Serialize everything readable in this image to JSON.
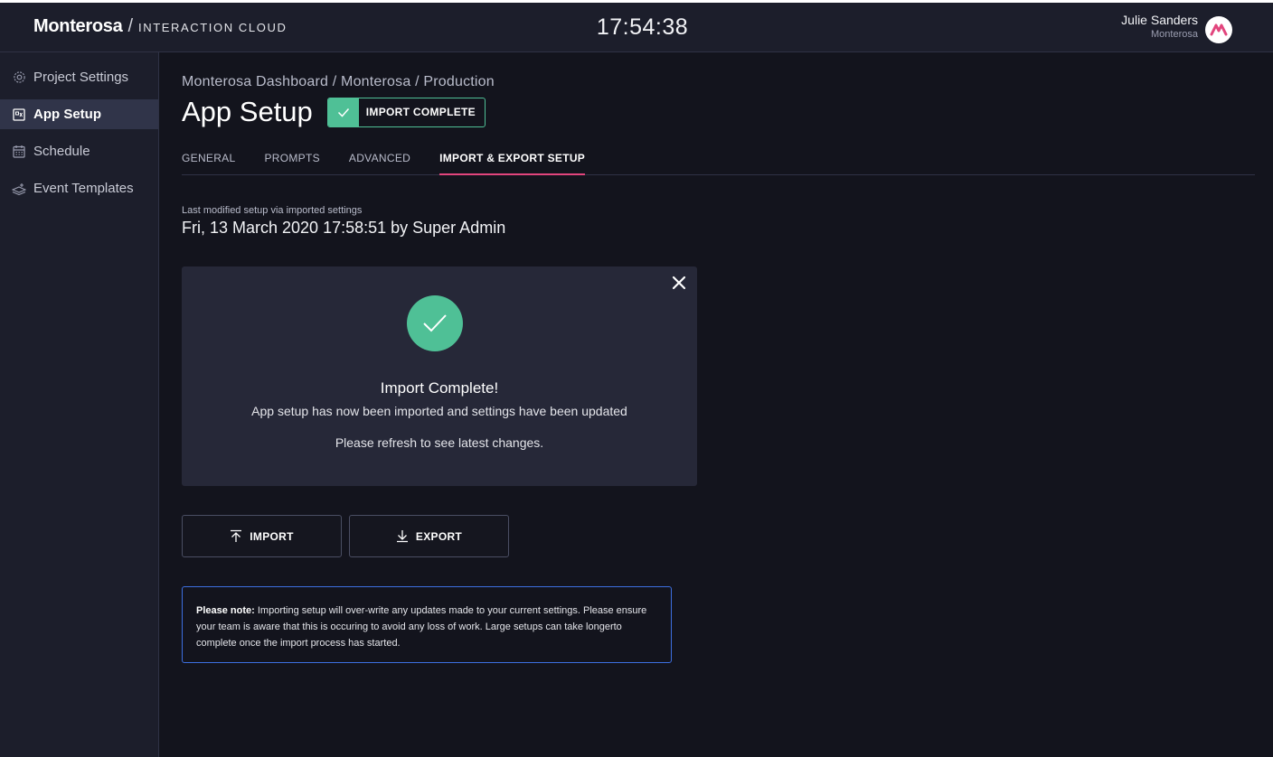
{
  "header": {
    "brand": "Monterosa",
    "brand_separator": "/",
    "product": "INTERACTION CLOUD",
    "clock": "17:54:38",
    "user_name": "Julie Sanders",
    "user_org": "Monterosa",
    "avatar_icon": "monterosa-logo-icon",
    "avatar_color": "#e2457d"
  },
  "sidebar": {
    "items": [
      {
        "label": "Project Settings",
        "icon": "gear-icon",
        "active": false
      },
      {
        "label": "App Setup",
        "icon": "app-setup-icon",
        "active": true
      },
      {
        "label": "Schedule",
        "icon": "calendar-icon",
        "active": false
      },
      {
        "label": "Event Templates",
        "icon": "templates-icon",
        "active": false
      }
    ]
  },
  "page": {
    "breadcrumb": "Monterosa Dashboard / Monterosa / Production",
    "title": "App Setup",
    "badge": "IMPORT COMPLETE",
    "tabs": [
      {
        "label": "GENERAL",
        "active": false
      },
      {
        "label": "PROMPTS",
        "active": false
      },
      {
        "label": "ADVANCED",
        "active": false
      },
      {
        "label": "IMPORT & EXPORT SETUP",
        "active": true
      }
    ],
    "last_modified_label": "Last modified setup via imported settings",
    "last_modified_value": "Fri, 13 March 2020 17:58:51 by Super Admin"
  },
  "panel": {
    "title": "Import Complete!",
    "message": "App setup has now been imported and settings have been updated",
    "refresh": "Please refresh to see latest changes."
  },
  "actions": {
    "import_label": "IMPORT",
    "export_label": "EXPORT"
  },
  "note": {
    "bold": "Please note:",
    "text": " Importing setup will over-write any updates made to your current settings. Please ensure your team is aware that this is occuring to avoid any loss of work. Large setups can take longerto complete once the import process has started."
  },
  "colors": {
    "accent_green": "#4fc096",
    "accent_pink": "#e2457d",
    "note_border": "#3d6fe0",
    "background": "#13141d",
    "surface": "#1c1e2b"
  }
}
